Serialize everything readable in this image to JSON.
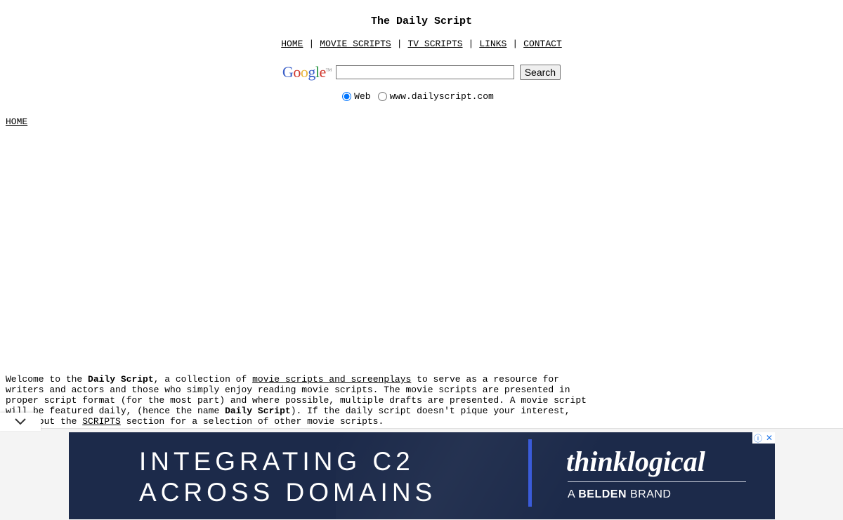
{
  "site": {
    "title": "The Daily Script"
  },
  "nav": [
    "HOME",
    "MOVIE SCRIPTS",
    "TV SCRIPTS",
    "LINKS",
    "CONTACT"
  ],
  "search": {
    "logo": "Google",
    "button_label": "Search",
    "options": [
      "Web",
      "www.dailyscript.com"
    ],
    "selected": "Web"
  },
  "breadcrumb": {
    "home": "HOME"
  },
  "welcome": {
    "p1": "Welcome to the ",
    "b1": "Daily Script",
    "p2": ", a collection of ",
    "link1": "movie scripts and screenplays",
    "p3": " to serve as a resource for\nwriters and actors and those who simply enjoy reading movie scripts. The movie scripts are presented in\nproper script format (for the most part) and where possible, multiple drafts are presented. A movie script\nwill be featured daily, (hence the name ",
    "b2": "Daily Script",
    "p4": "). If the daily script doesn't pique your interest,\ncheck out the ",
    "link2": "SCRIPTS",
    "p5": " section for a selection of other movie scripts."
  },
  "ad": {
    "headline": "INTEGRATING C2\nACROSS DOMAINS",
    "brand": "thinklogical",
    "sub_prefix": "A ",
    "sub_bold": "BELDEN",
    "sub_suffix": " BRAND",
    "accent_color": "#3a5bd9",
    "background_color": "#1c2a4a",
    "icons": [
      "info-icon",
      "close-icon"
    ]
  }
}
